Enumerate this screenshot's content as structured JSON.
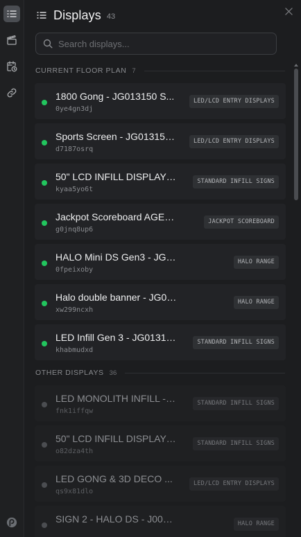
{
  "panel": {
    "title": "Displays",
    "count": "43",
    "search_placeholder": "Search displays..."
  },
  "sections": [
    {
      "label": "CURRENT FLOOR PLAN",
      "count": "7",
      "items": [
        {
          "name": "1800 Gong - JG013150 S...",
          "id": "0ye4gn3dj",
          "tag": "LED/LCD ENTRY DISPLAYS",
          "status": "online"
        },
        {
          "name": "Sports Screen - JG013150...",
          "id": "d7187osrq",
          "tag": "LED/LCD ENTRY DISPLAYS",
          "status": "online"
        },
        {
          "name": "50\" LCD INFILL DISPLAY - ...",
          "id": "kyaa5yo6t",
          "tag": "STANDARD INFILL SIGNS",
          "status": "online"
        },
        {
          "name": "Jackpot Scoreboard AGE202...",
          "id": "g0jnq8up6",
          "tag": "JACKPOT SCOREBOARD",
          "status": "online"
        },
        {
          "name": "HALO Mini DS Gen3 - JG013150 S/N...",
          "id": "0fpeixoby",
          "tag": "HALO RANGE",
          "status": "online"
        },
        {
          "name": "Halo double banner - JG013150 S/N...",
          "id": "xw299ncxh",
          "tag": "HALO RANGE",
          "status": "online"
        },
        {
          "name": "LED Infill Gen 3 - JG01315...",
          "id": "khabmudxd",
          "tag": "STANDARD INFILL SIGNS",
          "status": "online"
        }
      ]
    },
    {
      "label": "OTHER DISPLAYS",
      "count": "36",
      "items": [
        {
          "name": "LED MONOLITH INFILL - J...",
          "id": "fnk1iffqw",
          "tag": "STANDARD INFILL SIGNS",
          "status": "offline"
        },
        {
          "name": "50\" LCD INFILL DISPLAY - ...",
          "id": "o82dza4th",
          "tag": "STANDARD INFILL SIGNS",
          "status": "offline"
        },
        {
          "name": "LED GONG & 3D DECO ...",
          "id": "qs9x81dlo",
          "tag": "LED/LCD ENTRY DISPLAYS",
          "status": "offline"
        },
        {
          "name": "SIGN 2 - HALO DS - J009269 S/N0...",
          "id": "",
          "tag": "HALO RANGE",
          "status": "offline"
        }
      ]
    }
  ],
  "rail": {
    "icons": [
      "list-icon",
      "clapperboard-icon",
      "calendar-clock-icon",
      "link-icon",
      "app-logo-icon"
    ],
    "active": "list-icon"
  },
  "colors": {
    "online": "#22c55e",
    "offline": "#4b4d51",
    "background": "#1c1d1f",
    "card": "#222326"
  }
}
